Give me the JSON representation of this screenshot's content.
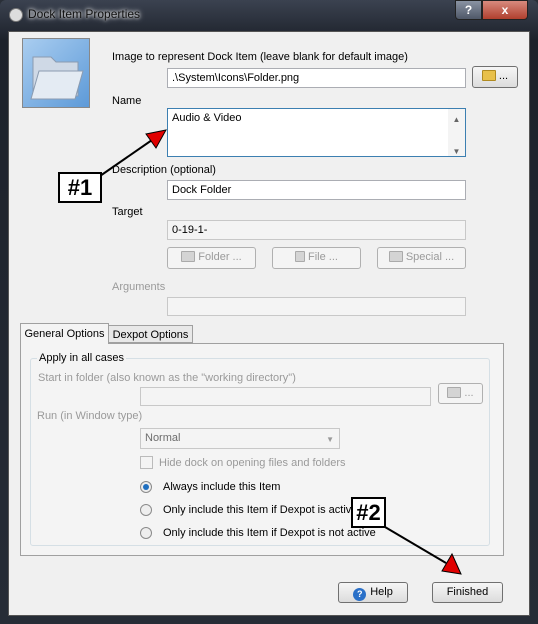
{
  "window": {
    "title": "Dock Item Properties",
    "help_glyph": "?",
    "close_glyph": "x"
  },
  "image": {
    "label": "Image to represent Dock Item (leave blank for default image)",
    "value": ".\\System\\Icons\\Folder.png",
    "browse_label": "..."
  },
  "name": {
    "label": "Name",
    "value": "Audio & Video"
  },
  "description": {
    "label": "Description (optional)",
    "value": "Dock Folder"
  },
  "target": {
    "label": "Target",
    "value": "0-19-1-",
    "buttons": [
      "Folder ...",
      "File ...",
      "Special ..."
    ]
  },
  "arguments": {
    "label": "Arguments",
    "value": ""
  },
  "tabs": [
    {
      "label": "General Options",
      "active": true
    },
    {
      "label": "Dexpot Options",
      "active": false
    }
  ],
  "general": {
    "group_label": "Apply in all cases",
    "start_in_label": "Start in folder (also known as the \"working directory\")",
    "start_in_value": "",
    "browse_label": "...",
    "run_label": "Run (in  Window type)",
    "run_value": "Normal",
    "hide_dock_label": "Hide dock on opening files and folders",
    "hide_dock_checked": false,
    "radios": [
      {
        "label": "Always include this Item",
        "checked": true
      },
      {
        "label": "Only include this Item if Dexpot is active",
        "checked": false
      },
      {
        "label": "Only include this Item if Dexpot is not active",
        "checked": false
      }
    ]
  },
  "footer": {
    "help_label": "Help",
    "finished_label": "Finished"
  },
  "annotations": [
    "#1",
    "#2"
  ],
  "colors": {
    "arrow_head": "#e00000",
    "accent": "#1f6fc0"
  }
}
